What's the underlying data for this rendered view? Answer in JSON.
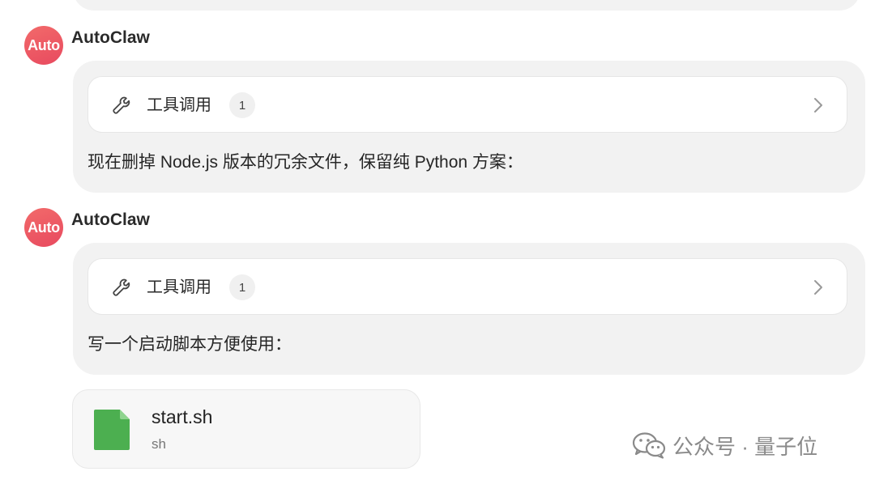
{
  "colors": {
    "avatar_gradient_start": "#f26a6a",
    "avatar_gradient_end": "#e84a5f",
    "bubble_bg": "#f2f2f2",
    "file_icon_green": "#4caf50"
  },
  "messages": [
    {
      "avatar_text": "Auto",
      "sender": "AutoClaw",
      "tool_call": {
        "label": "工具调用",
        "count": "1",
        "icon": "wrench-icon",
        "chevron": "chevron-right-icon"
      },
      "text": "现在删掉 Node.js 版本的冗余文件，保留纯 Python 方案："
    },
    {
      "avatar_text": "Auto",
      "sender": "AutoClaw",
      "tool_call": {
        "label": "工具调用",
        "count": "1",
        "icon": "wrench-icon",
        "chevron": "chevron-right-icon"
      },
      "text": "写一个启动脚本方便使用："
    }
  ],
  "file": {
    "name": "start.sh",
    "type": "sh",
    "icon": "file-icon"
  },
  "watermark": {
    "icon": "wechat-icon",
    "text": "公众号 · 量子位"
  }
}
